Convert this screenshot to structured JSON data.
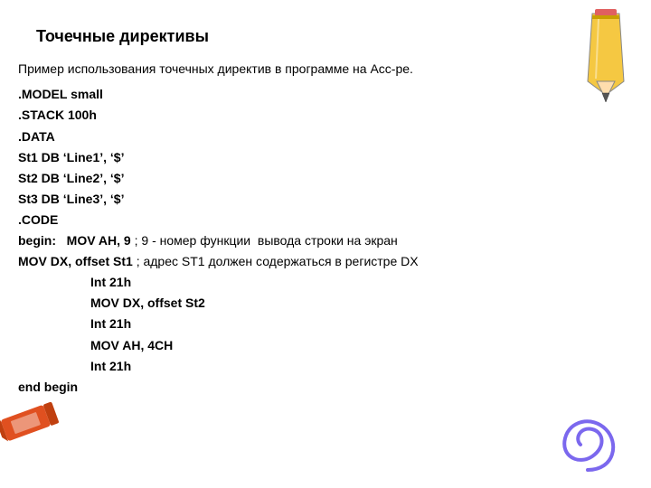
{
  "slide": {
    "title": "Точечные директивы",
    "intro": "Пример использования точечных директив в программе на Асс-ре.",
    "code_lines": [
      {
        "text": ".MODEL small",
        "indent": false
      },
      {
        "text": ".STACK 100h",
        "indent": false
      },
      {
        "text": ".DATA",
        "indent": false
      },
      {
        "text": "St1  DB  ‘Line1’, ‘$’",
        "indent": false
      },
      {
        "text": "St2  DB  ‘Line2’, ‘$’",
        "indent": false
      },
      {
        "text": "St3  DB  ‘Line3’, ‘$’",
        "indent": false
      },
      {
        "text": ".CODE",
        "indent": false
      },
      {
        "text": "begin:   MOV AH, 9",
        "indent": false,
        "comment": " ; 9 -  номер функции  вывода строки на экран"
      },
      {
        "text": "MOV DX, offset St1",
        "indent": false,
        "comment": "  ; адрес ST1 должен содержаться в регистре DX"
      },
      {
        "text": "Int 21h",
        "indent": true
      },
      {
        "text": "MOV DX, offset St2",
        "indent": true
      },
      {
        "text": "Int 21h",
        "indent": true
      },
      {
        "text": "MOV AH, 4CH",
        "indent": true
      },
      {
        "text": "Int 21h",
        "indent": true
      },
      {
        "text": "end begin",
        "indent": false
      }
    ]
  },
  "decorations": {
    "pencil_top_right": "pencil-icon",
    "pencil_bottom_left": "crayon-icon",
    "swirl_bottom_right": "swirl-icon"
  }
}
